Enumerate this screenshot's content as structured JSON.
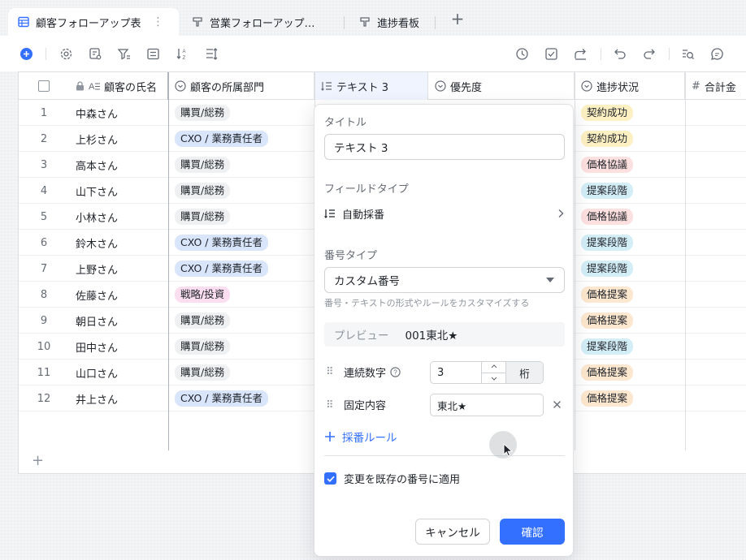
{
  "tabs": [
    {
      "label": "顧客フォローアップ表",
      "active": true
    },
    {
      "label": "営業フォローアップ…",
      "active": false
    },
    {
      "label": "進捗看板",
      "active": false
    }
  ],
  "columns": [
    {
      "label": "顧客の氏名"
    },
    {
      "label": "顧客の所属部門"
    },
    {
      "label": "テキスト 3"
    },
    {
      "label": "優先度"
    },
    {
      "label": "進捗状況"
    },
    {
      "label": "合計金"
    }
  ],
  "rows": [
    {
      "no": "1",
      "name": "中森さん",
      "dept": "購買/総務",
      "status": "契約成功"
    },
    {
      "no": "2",
      "name": "上杉さん",
      "dept": "CXO / 業務責任者",
      "status": "契約成功"
    },
    {
      "no": "3",
      "name": "高本さん",
      "dept": "購買/総務",
      "status": "価格協議"
    },
    {
      "no": "4",
      "name": "山下さん",
      "dept": "購買/総務",
      "status": "提案段階"
    },
    {
      "no": "5",
      "name": "小林さん",
      "dept": "購買/総務",
      "status": "価格協議"
    },
    {
      "no": "6",
      "name": "鈴木さん",
      "dept": "CXO / 業務責任者",
      "status": "提案段階"
    },
    {
      "no": "7",
      "name": "上野さん",
      "dept": "CXO / 業務責任者",
      "status": "提案段階"
    },
    {
      "no": "8",
      "name": "佐藤さん",
      "dept": "戦略/投資",
      "status": "価格提案"
    },
    {
      "no": "9",
      "name": "朝日さん",
      "dept": "購買/総務",
      "status": "価格提案"
    },
    {
      "no": "10",
      "name": "田中さん",
      "dept": "購買/総務",
      "status": "提案段階"
    },
    {
      "no": "11",
      "name": "山口さん",
      "dept": "購買/総務",
      "status": "価格提案"
    },
    {
      "no": "12",
      "name": "井上さん",
      "dept": "CXO / 業務責任者",
      "status": "価格提案"
    }
  ],
  "tag_colors": {
    "購買/総務": "#eff0f1",
    "CXO / 業務責任者": "#d9e5fb",
    "戦略/投資": "#fbdff0",
    "契約成功": "#fdf0c3",
    "価格協議": "#fde0e0",
    "提案段階": "#d4eef8",
    "価格提案": "#fde7cf"
  },
  "popup": {
    "title_label": "タイトル",
    "title_value": "テキスト 3",
    "field_type_label": "フィールドタイプ",
    "field_type_value": "自動採番",
    "number_type_label": "番号タイプ",
    "number_type_value": "カスタム番号",
    "number_type_hint": "番号・テキストの形式やルールをカスタマイズする",
    "preview_label": "プレビュー",
    "preview_value": "001東北★",
    "seq_label": "連続数字",
    "seq_value": "3",
    "seq_unit": "桁",
    "fixed_label": "固定内容",
    "fixed_value": "東北★",
    "add_rule": "採番ルール",
    "apply_existing": "変更を既存の番号に適用",
    "apply_checked": true,
    "cancel": "キャンセル",
    "confirm": "確認"
  },
  "accent_color": "#3370ff"
}
